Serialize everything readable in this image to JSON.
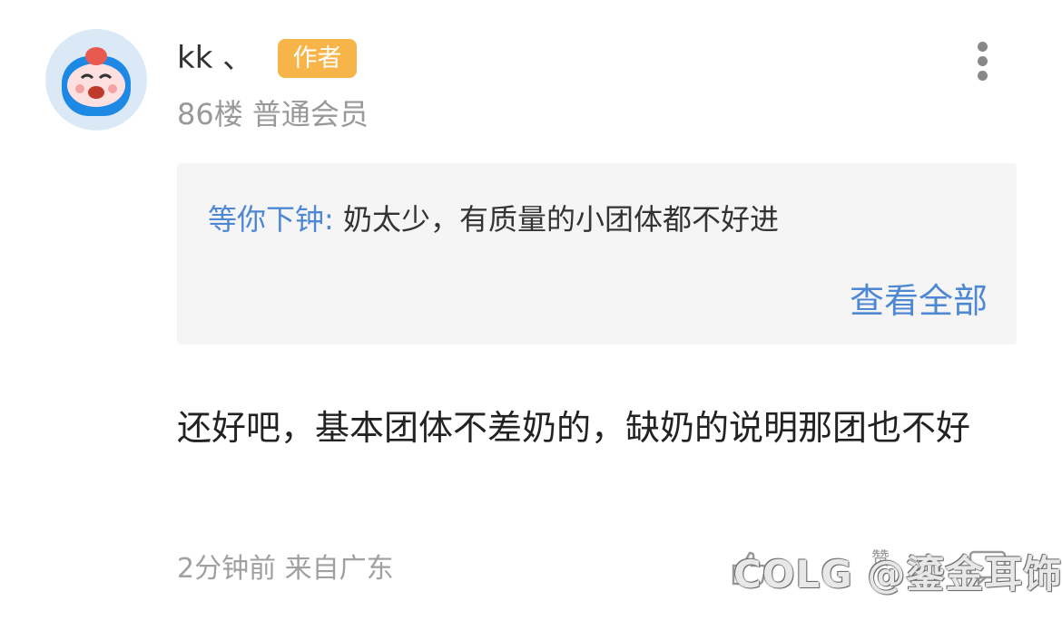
{
  "post": {
    "username": "kk 、",
    "author_badge": "作者",
    "floor_info": "86楼 普通会员",
    "quote": {
      "author": "等你下钟:",
      "text": " 奶太少，有质量的小团体都不好进",
      "view_all": "查看全部"
    },
    "content": "还好吧，基本团体不差奶的，缺奶的说明那团也不好",
    "footer": "2分钟前 来自广东",
    "like_label": "赞",
    "watermark": "COLG @鎏金耳饰"
  },
  "colors": {
    "link": "#4e88d4",
    "badge": "#f7b449",
    "meta": "#999999",
    "quote_bg": "#f5f5f5"
  }
}
